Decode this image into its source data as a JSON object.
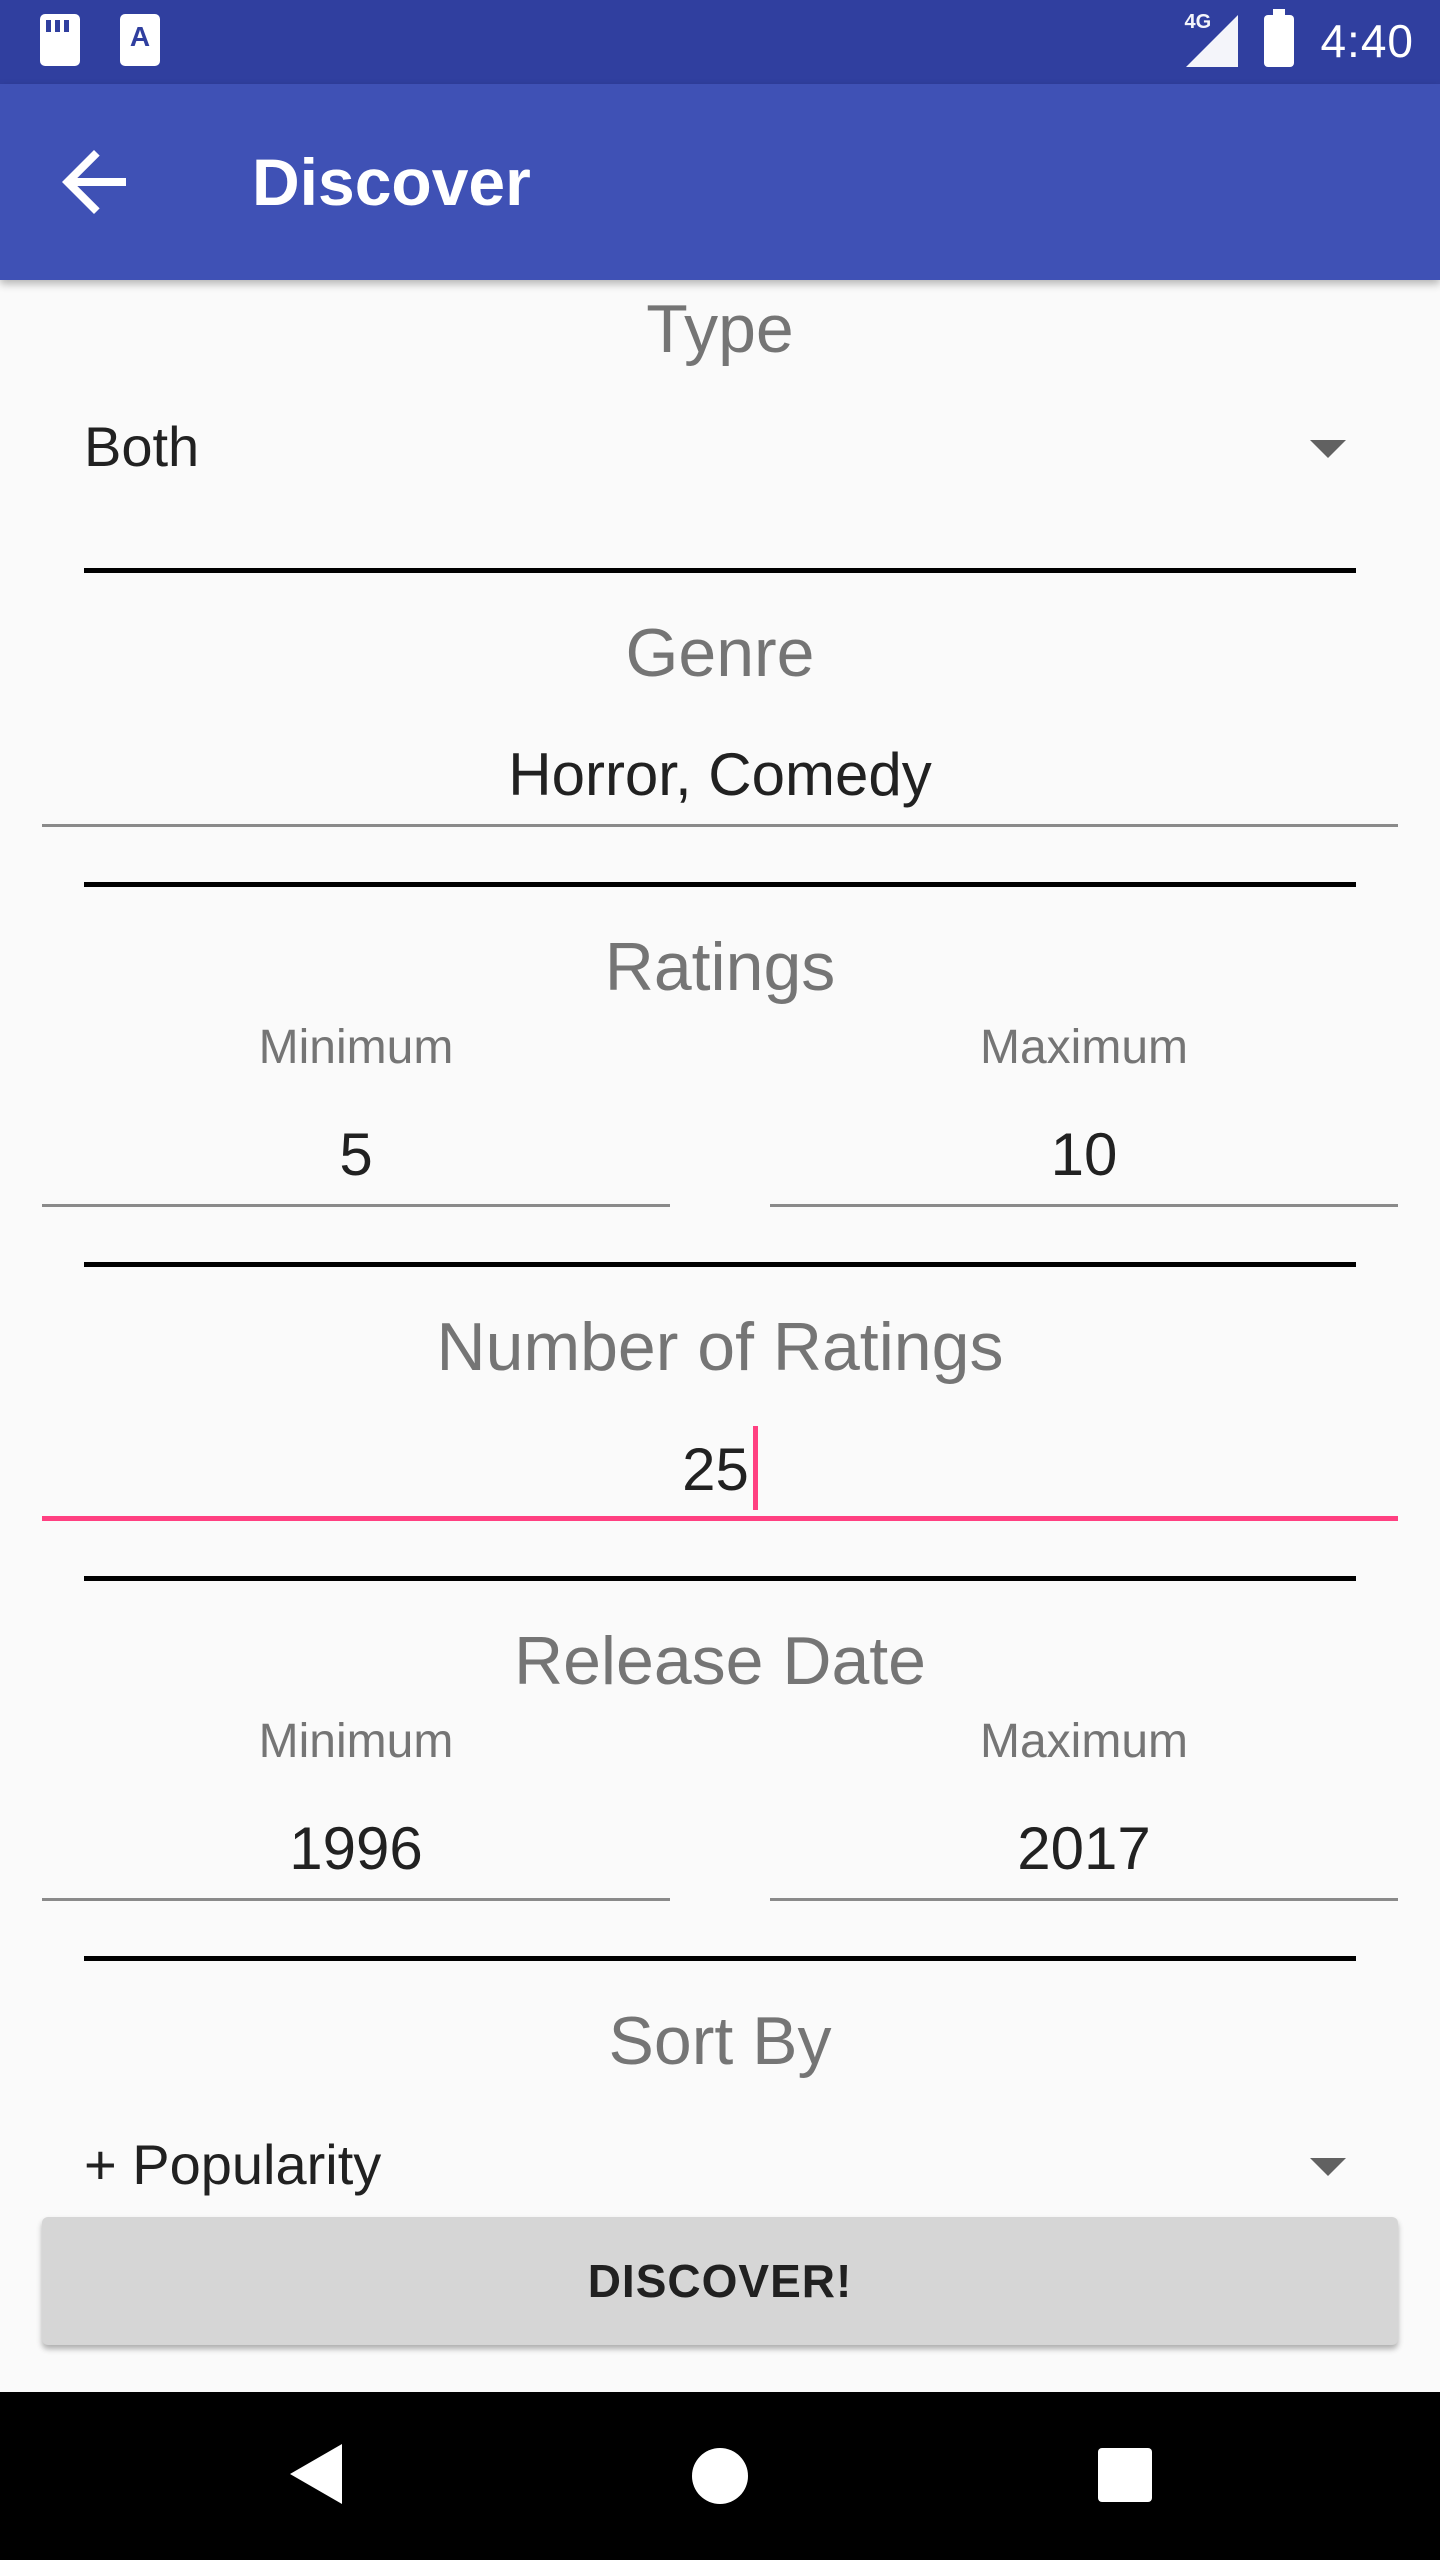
{
  "status_bar": {
    "time": "4:40",
    "network": "4G"
  },
  "app_bar": {
    "title": "Discover"
  },
  "type_section": {
    "title": "Type",
    "selected": "Both"
  },
  "genre_section": {
    "title": "Genre",
    "value": "Horror, Comedy"
  },
  "ratings_section": {
    "title": "Ratings",
    "min_label": "Minimum",
    "min_value": "5",
    "max_label": "Maximum",
    "max_value": "10"
  },
  "num_ratings_section": {
    "title": "Number of Ratings",
    "value": "25"
  },
  "release_section": {
    "title": "Release Date",
    "min_label": "Minimum",
    "min_value": "1996",
    "max_label": "Maximum",
    "max_value": "2017"
  },
  "sort_section": {
    "title": "Sort By",
    "selected": "+ Popularity"
  },
  "discover_button": {
    "label": "DISCOVER!"
  },
  "colors": {
    "status_bar": "#303f9f",
    "app_bar": "#3f51b5",
    "accent": "#ff4081"
  }
}
